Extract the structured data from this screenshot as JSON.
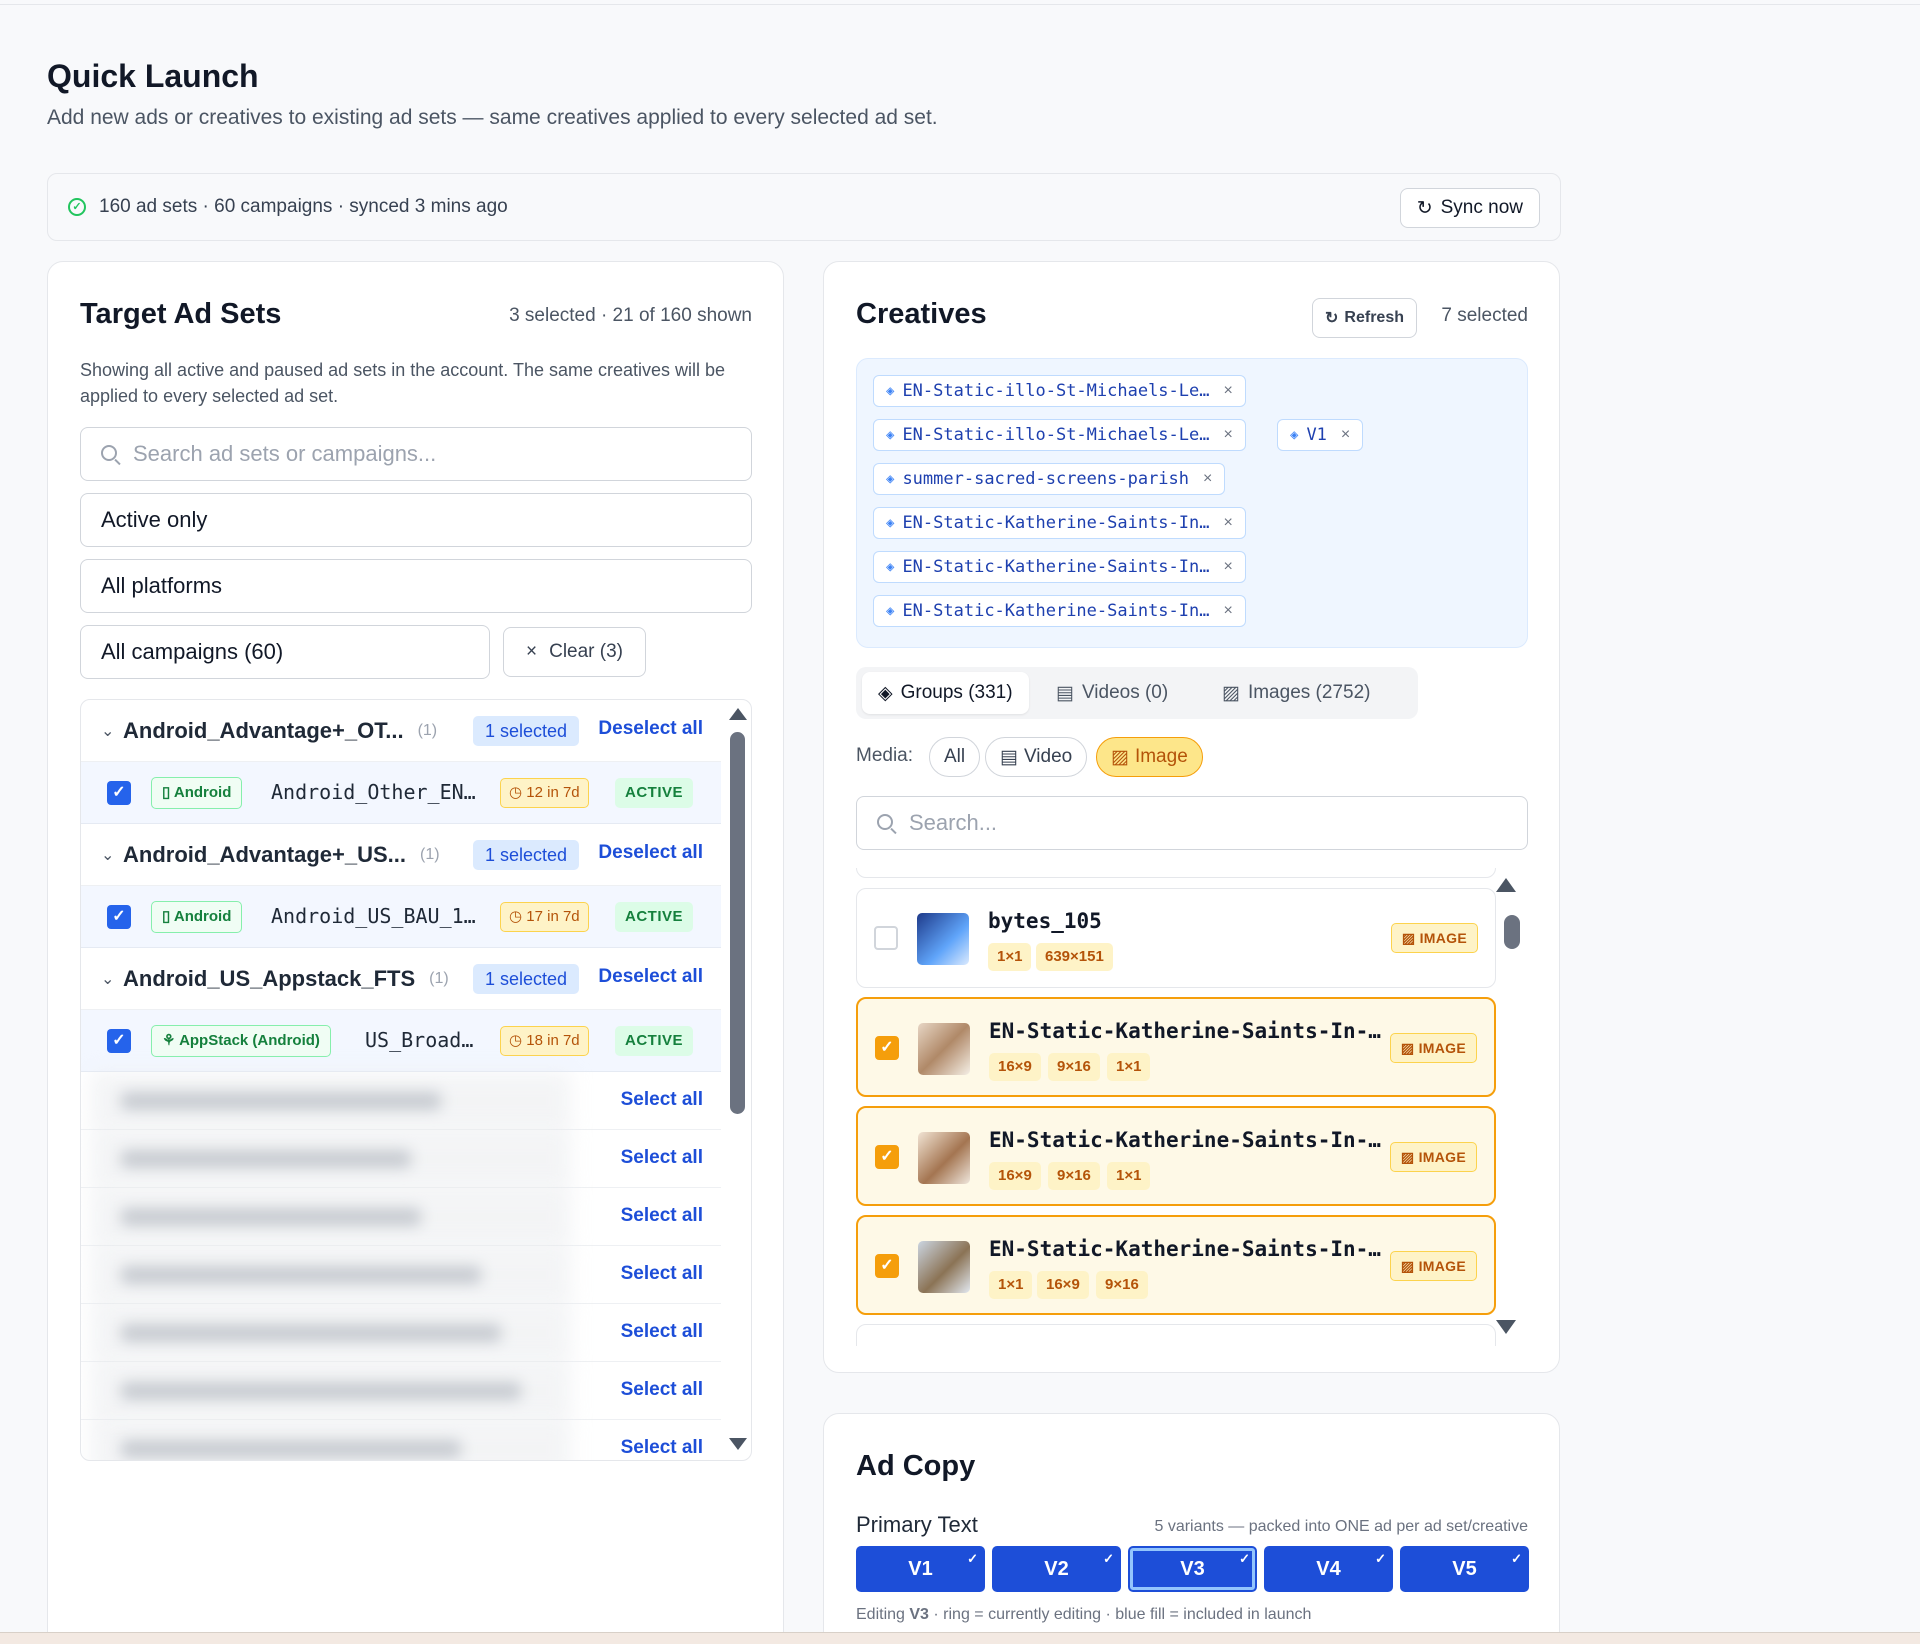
{
  "page": {
    "title": "Quick Launch",
    "subtitle": "Add new ads or creatives to existing ad sets — same creatives applied to every selected ad set."
  },
  "sync": {
    "status": "160 ad sets · 60 campaigns · synced 3 mins ago",
    "button": "Sync now"
  },
  "target": {
    "title": "Target Ad Sets",
    "count": "3 selected · 21 of 160 shown",
    "description": "Showing all active and paused ad sets in the account. The same creatives will be applied to every selected ad set.",
    "search_placeholder": "Search ad sets or campaigns...",
    "status_filter": "Active only",
    "platform_filter": "All platforms",
    "campaign_filter": "All campaigns (60)",
    "clear_label": "Clear (3)",
    "groups": [
      {
        "name": "Android_Advantage+_OT...",
        "count": "(1)",
        "selected": "1 selected",
        "action": "Deselect all",
        "row": {
          "platform": "Android",
          "name": "Android_Other_EN…",
          "freq": "12 in 7d",
          "status": "ACTIVE"
        }
      },
      {
        "name": "Android_Advantage+_US...",
        "count": "(1)",
        "selected": "1 selected",
        "action": "Deselect all",
        "row": {
          "platform": "Android",
          "name": "Android_US_BAU_1…",
          "freq": "17 in 7d",
          "status": "ACTIVE"
        }
      },
      {
        "name": "Android_US_Appstack_FTS",
        "count": "(1)",
        "selected": "1 selected",
        "action": "Deselect all",
        "row": {
          "platform": "AppStack (Android)",
          "name": "US_Broad…",
          "freq": "18 in 7d",
          "status": "ACTIVE"
        }
      }
    ],
    "collapsed_actions": [
      "Select all",
      "Select all",
      "Select all",
      "Select all",
      "Select all",
      "Select all",
      "Select all"
    ]
  },
  "creatives": {
    "title": "Creatives",
    "refresh": "Refresh",
    "selected": "7 selected",
    "chips": [
      "EN-Static-illo-St-Michaels-Le…",
      "EN-Static-illo-St-Michaels-Le…",
      "V1",
      "summer-sacred-screens-parish",
      "EN-Static-Katherine-Saints-In…",
      "EN-Static-Katherine-Saints-In…",
      "EN-Static-Katherine-Saints-In…"
    ],
    "tabs": [
      "Groups (331)",
      "Videos (0)",
      "Images (2752)"
    ],
    "media_label": "Media:",
    "media": [
      "All",
      "Video",
      "Image"
    ],
    "search_placeholder": "Search...",
    "items": [
      {
        "name": "bytes_105",
        "ratios": [
          "1×1",
          "639×151"
        ],
        "type": "IMAGE",
        "checked": false
      },
      {
        "name": "EN-Static-Katherine-Saints-In-…",
        "ratios": [
          "16×9",
          "9×16",
          "1×1"
        ],
        "type": "IMAGE",
        "checked": true
      },
      {
        "name": "EN-Static-Katherine-Saints-In-…",
        "ratios": [
          "16×9",
          "9×16",
          "1×1"
        ],
        "type": "IMAGE",
        "checked": true
      },
      {
        "name": "EN-Static-Katherine-Saints-In-…",
        "ratios": [
          "1×1",
          "16×9",
          "9×16"
        ],
        "type": "IMAGE",
        "checked": true
      }
    ]
  },
  "adcopy": {
    "title": "Ad Copy",
    "primary_label": "Primary Text",
    "note": "5 variants — packed into ONE ad per ad set/creative",
    "variants": [
      "V1",
      "V2",
      "V3",
      "V4",
      "V5"
    ],
    "editing_prefix": "Editing ",
    "editing_variant": "V3",
    "editing_suffix": " · ring = currently editing · blue fill = included in launch"
  },
  "icons": {
    "check": "✓",
    "close": "×",
    "chevron": "⌄",
    "refresh": "↻",
    "layers": "◈",
    "clock": "◷"
  },
  "colors": {
    "primary": "#1d4ed8",
    "success": "#15803d",
    "warning": "#b45309",
    "highlight": "#f59e0b"
  }
}
